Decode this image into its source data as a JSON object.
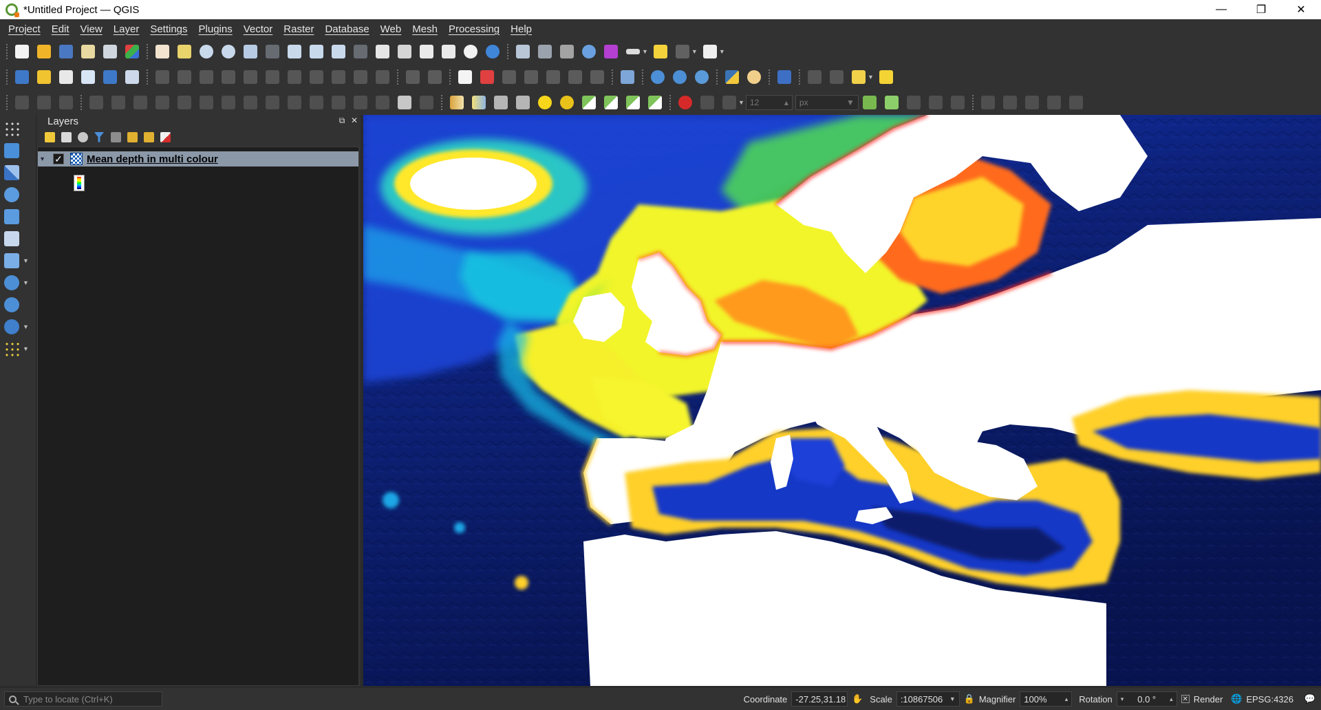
{
  "window": {
    "title": "*Untitled Project — QGIS",
    "minimize_glyph": "—",
    "restore_glyph": "❐",
    "close_glyph": "✕"
  },
  "menu": [
    "Project",
    "Edit",
    "View",
    "Layer",
    "Settings",
    "Plugins",
    "Vector",
    "Raster",
    "Database",
    "Web",
    "Mesh",
    "Processing",
    "Help"
  ],
  "toolbar": {
    "font_size_value": "12",
    "font_unit_value": "px"
  },
  "layers_panel": {
    "title": "Layers",
    "layer": {
      "name": "Mean depth in multi colour",
      "checked": true,
      "check_glyph": "✓",
      "expander_glyph": "▾"
    }
  },
  "map": {
    "colors": {
      "land": "#ffffff",
      "deep_ocean": "#0a1a5c",
      "mid_ocean": "#1e3fd0",
      "shelf_blue": "#00b4e6",
      "shelf_green": "#5ee04a",
      "shallow_yellow": "#f0f52a",
      "coast_orange": "#ff9a1e",
      "coast_red": "#ff1e1e"
    }
  },
  "statusbar": {
    "locator_placeholder": "Type to locate (Ctrl+K)",
    "coordinate_label": "Coordinate",
    "coordinate_value": "-27.25,31.18",
    "scale_label": "Scale",
    "scale_value": ":10867506",
    "magnifier_label": "Magnifier",
    "magnifier_value": "100%",
    "rotation_label": "Rotation",
    "rotation_value": "0.0 °",
    "render_label": "Render",
    "render_checked": true,
    "crs_value": "EPSG:4326"
  }
}
